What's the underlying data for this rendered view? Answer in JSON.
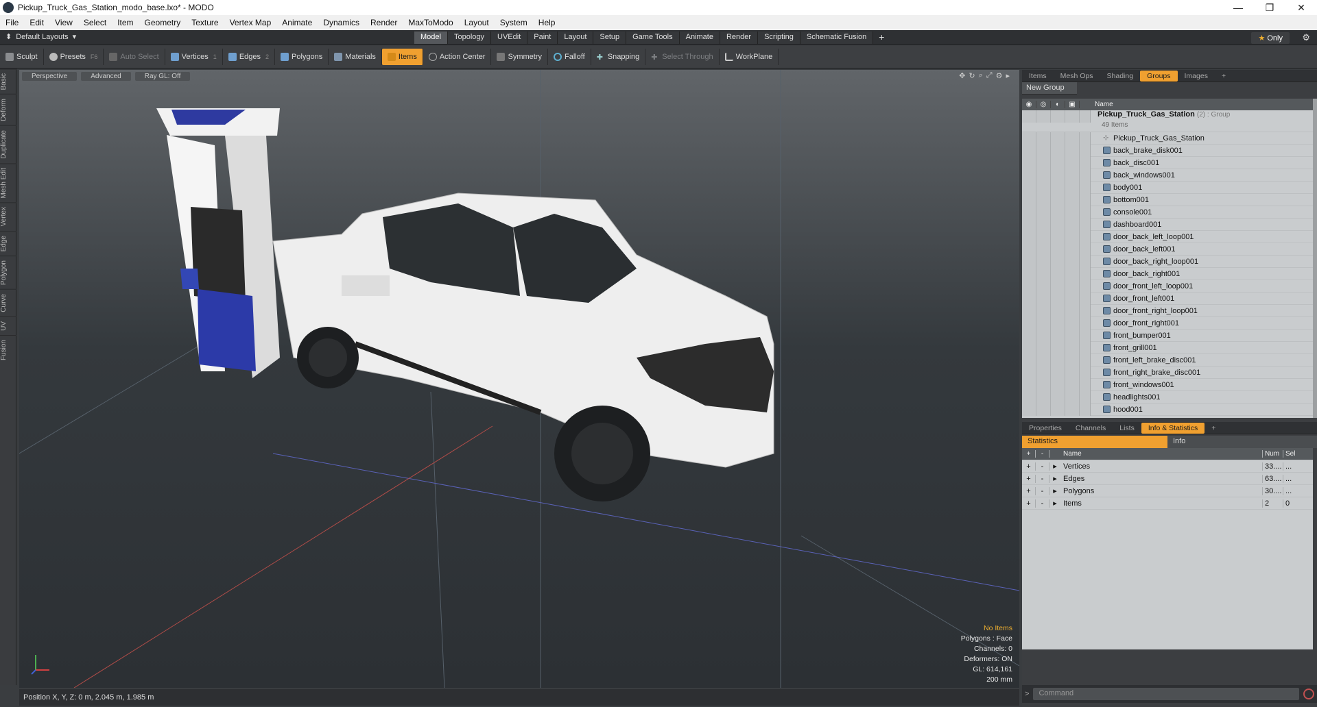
{
  "window": {
    "title": "Pickup_Truck_Gas_Station_modo_base.lxo* - MODO",
    "min": "—",
    "max": "❐",
    "close": "✕"
  },
  "menu": [
    "File",
    "Edit",
    "View",
    "Select",
    "Item",
    "Geometry",
    "Texture",
    "Vertex Map",
    "Animate",
    "Dynamics",
    "Render",
    "MaxToModo",
    "Layout",
    "System",
    "Help"
  ],
  "layoutbar": {
    "layout_name": "Default Layouts",
    "tabs": [
      "Model",
      "Topology",
      "UVEdit",
      "Paint",
      "Layout",
      "Setup",
      "Game Tools",
      "Animate",
      "Render",
      "Scripting",
      "Schematic Fusion"
    ],
    "active_tab": "Model",
    "only_label": "Only"
  },
  "toolbar": {
    "sculpt": "Sculpt",
    "presets": "Presets",
    "presets_key": "F6",
    "auto_select": "Auto Select",
    "vertices": "Vertices",
    "vertices_key": "1",
    "edges": "Edges",
    "edges_key": "2",
    "polygons": "Polygons",
    "materials": "Materials",
    "items": "Items",
    "action_center": "Action Center",
    "symmetry": "Symmetry",
    "falloff": "Falloff",
    "snapping": "Snapping",
    "select_through": "Select Through",
    "workplane": "WorkPlane"
  },
  "left_tabs": [
    "Basic",
    "Deform",
    "Duplicate",
    "Mesh Edit",
    "Vertex",
    "Edge",
    "Polygon",
    "Curve",
    "UV",
    "Fusion"
  ],
  "viewport": {
    "view": "Perspective",
    "shading": "Advanced",
    "raygl": "Ray GL: Off",
    "hud": {
      "no_items": "No Items",
      "polygons": "Polygons : Face",
      "channels": "Channels: 0",
      "deformers": "Deformers: ON",
      "gl": "GL: 614,161",
      "scale": "200 mm"
    }
  },
  "status": {
    "position": "Position X, Y, Z:  0 m, 2.045 m, 1.985 m"
  },
  "items_panel": {
    "tabs": [
      "Items",
      "Mesh Ops",
      "Shading",
      "Groups",
      "Images"
    ],
    "active_tab": "Groups",
    "new_group": "New Group",
    "name_header": "Name",
    "group": {
      "name": "Pickup_Truck_Gas_Station",
      "suffix": "(2) : Group",
      "count": "49 Items"
    },
    "items": [
      "Pickup_Truck_Gas_Station",
      "back_brake_disk001",
      "back_disc001",
      "back_windows001",
      "body001",
      "bottom001",
      "console001",
      "dashboard001",
      "door_back_left_loop001",
      "door_back_left001",
      "door_back_right_loop001",
      "door_back_right001",
      "door_front_left_loop001",
      "door_front_left001",
      "door_front_right_loop001",
      "door_front_right001",
      "front_bumper001",
      "front_grill001",
      "front_left_brake_disc001",
      "front_right_brake_disc001",
      "front_windows001",
      "headlights001",
      "hood001"
    ]
  },
  "stats_panel": {
    "tabs": [
      "Properties",
      "Channels",
      "Lists",
      "Info & Statistics"
    ],
    "active_tab": "Info & Statistics",
    "sub_statistics": "Statistics",
    "sub_info": "Info",
    "headers": {
      "name": "Name",
      "num": "Num",
      "sel": "Sel"
    },
    "rows": [
      {
        "name": "Vertices",
        "num": "33....",
        "sel": "..."
      },
      {
        "name": "Edges",
        "num": "63....",
        "sel": "..."
      },
      {
        "name": "Polygons",
        "num": "30....",
        "sel": "..."
      },
      {
        "name": "Items",
        "num": "2",
        "sel": "0"
      }
    ]
  },
  "command": {
    "placeholder": "Command"
  }
}
